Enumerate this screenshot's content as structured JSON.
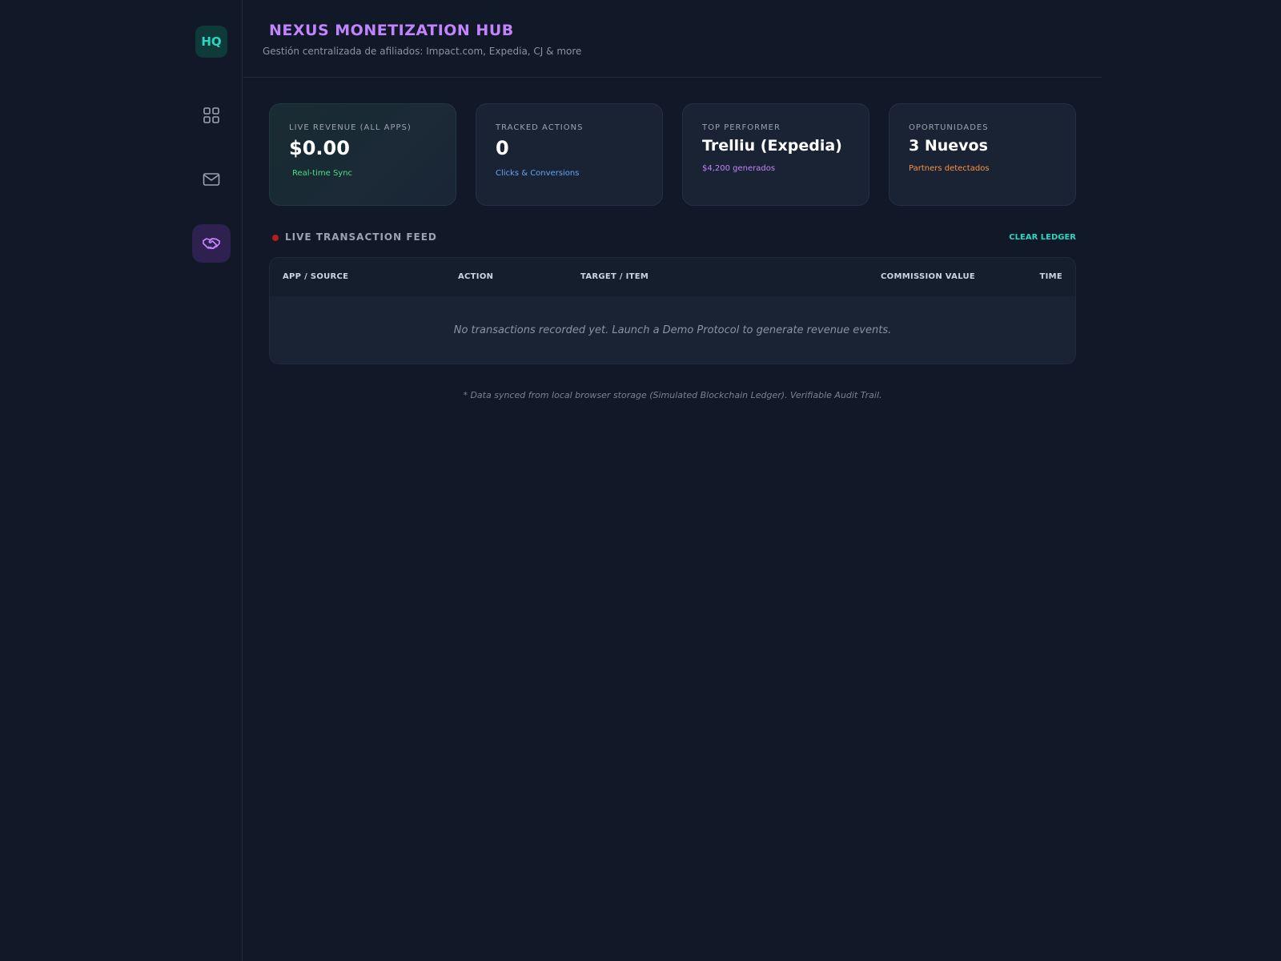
{
  "sidebar": {
    "logo_text": "HQ",
    "nav": [
      {
        "icon": "grid-icon"
      },
      {
        "icon": "mail-icon"
      },
      {
        "icon": "handshake-icon",
        "active": true
      }
    ]
  },
  "header": {
    "title": "NEXUS MONETIZATION HUB",
    "subtitle": "Gestión centralizada de afiliados: Impact.com, Expedia, CJ & more"
  },
  "cards": [
    {
      "label": "LIVE REVENUE (ALL APPS)",
      "value": "$0.00",
      "note": "Real-time Sync"
    },
    {
      "label": "TRACKED ACTIONS",
      "value": "0",
      "note": "Clicks & Conversions"
    },
    {
      "label": "TOP PERFORMER",
      "value": "Trelliu (Expedia)",
      "note": "$4,200 generados"
    },
    {
      "label": "OPORTUNIDADES",
      "value": "3 Nuevos",
      "note": "Partners detectados"
    }
  ],
  "feed": {
    "title": "LIVE TRANSACTION FEED",
    "clear_label": "CLEAR LEDGER",
    "columns": [
      "APP / SOURCE",
      "ACTION",
      "TARGET / ITEM",
      "COMMISSION VALUE",
      "TIME"
    ],
    "rows": [],
    "empty_message": "No transactions recorded yet. Launch a Demo Protocol to generate revenue events."
  },
  "footnote": "* Data synced from local browser storage (Simulated Blockchain Ledger). Verifiable Audit Trail.",
  "colors": {
    "background": "#111827",
    "accent_teal": "#2dd4bf",
    "accent_purple": "#c084fc",
    "positive_green": "#4ade80",
    "info_blue": "#60a5fa",
    "warning_orange": "#fb923c",
    "live_red": "#b91c1c"
  }
}
